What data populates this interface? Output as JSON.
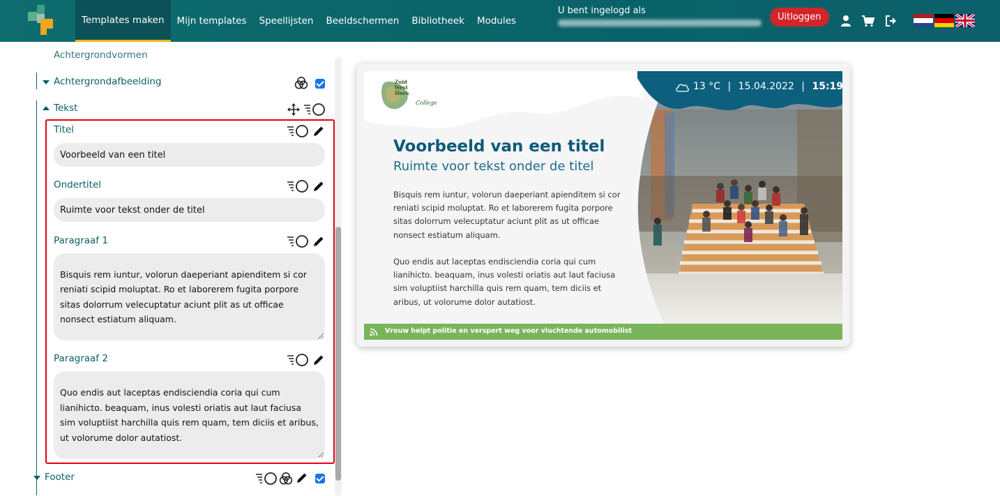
{
  "nav": {
    "items": [
      {
        "label": "Templates maken",
        "active": true
      },
      {
        "label": "Mijn templates",
        "active": false
      },
      {
        "label": "Speellijsten",
        "active": false
      },
      {
        "label": "Beeldschermen",
        "active": false
      },
      {
        "label": "Bibliotheek",
        "active": false
      },
      {
        "label": "Modules",
        "active": false
      }
    ],
    "login_label": "U bent ingelogd als",
    "logout_label": "Uitloggen",
    "icons": [
      "user-icon",
      "cart-icon",
      "sign-out-icon"
    ],
    "flags": [
      "flag-nl",
      "flag-de",
      "flag-uk"
    ]
  },
  "tree": {
    "achtergrondvormen": "Achtergrondvormen",
    "achtergrondafbeelding": "Achtergrondafbeelding",
    "tekst": "Tekst",
    "footer": "Footer"
  },
  "fields": {
    "titel": {
      "label": "Titel",
      "value": "Voorbeeld van een titel"
    },
    "ondertitel": {
      "label": "Ondertitel",
      "value": "Ruimte voor tekst onder de titel"
    },
    "paragraaf1": {
      "label": "Paragraaf 1",
      "value": "Bisquis rem iuntur, volorun daeperiant apienditem si cor reniati scipid moluptat.  Ro et laborerem fugita porpore sitas dolorrum velecuptatur aciunt plit as ut officae nonsect estiatum aliquam."
    },
    "paragraaf2": {
      "label": "Paragraaf 2",
      "value": "Quo endis aut laceptas endisciendia coria qui cum lianihicto. beaquam, inus volesti oriatis aut laut faciusa sim voluptiist harchilla quis rem quam, tem diciis et aribus, ut volorume dolor autatiost."
    }
  },
  "preview": {
    "logo_lines": [
      "Zuid",
      "West",
      "Hoek",
      "College"
    ],
    "temperature": "13 °C",
    "date": "15.04.2022",
    "time": "15:19",
    "separator": "|",
    "title": "Voorbeeld van een titel",
    "subtitle": "Ruimte voor tekst onder de titel",
    "paragraph1": "Bisquis rem iuntur, volorun daeperiant apienditem si cor reniati scipid moluptat. Ro et laborerem fugita porpore sitas dolorrum velecuptatur aciunt plit as ut officae nonsect estiatum aliquam.",
    "paragraph2": "Quo endis aut laceptas endisciendia coria qui cum lianihicto. beaquam, inus volesti oriatis aut laut faciusa sim voluptiist harchilla quis rem quam, tem diciis et aribus, ut volorume dolor autatiost.",
    "ticker": "Vrouw helpt politie en verspert weg voor vluchtende automobilist"
  },
  "colors": {
    "nav_bg": "#0b6468",
    "nav_active_underline": "#f2b21d",
    "logout_red": "#d3242a",
    "highlight_red": "#e3000f",
    "checkbox_blue": "#1a73e8",
    "preview_title": "#0e5a7a",
    "ticker_green": "#7ab55c"
  }
}
